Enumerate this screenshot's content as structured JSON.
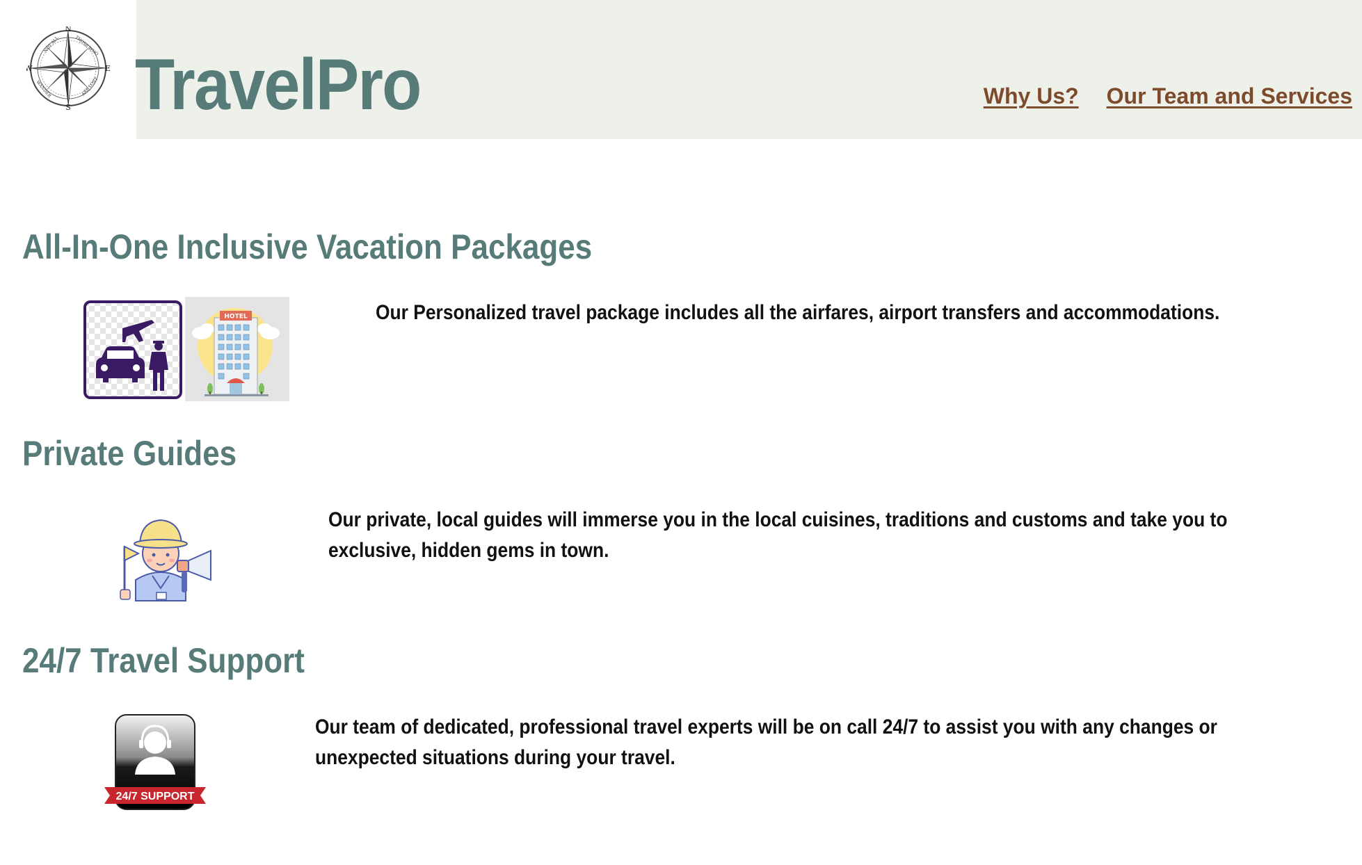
{
  "header": {
    "logo_icon": "compass-rose-icon",
    "logo_text": {
      "north": "N",
      "south": "S",
      "east": "E",
      "west": "W",
      "ring_top_left": "NOT ALL",
      "ring_top_right": "THOSE WHO",
      "ring_bottom_left": "WANDER",
      "ring_bottom_right": "ARE LOST"
    },
    "brand": "TravelPro",
    "nav": [
      {
        "label": "Why Us?"
      },
      {
        "label": "Our Team and Services"
      }
    ]
  },
  "sections": [
    {
      "title": "All-In-One Inclusive Vacation Packages",
      "icons": [
        "airport-transfer-icon",
        "hotel-icon"
      ],
      "hotel_sign": "HOTEL",
      "text": "Our Personalized travel package includes all the airfares, airport transfers and accommodations."
    },
    {
      "title": "Private Guides",
      "icons": [
        "tour-guide-icon"
      ],
      "text": "Our private, local guides will immerse you in the local cuisines, traditions and customs and take you to exclusive, hidden gems in town."
    },
    {
      "title": "24/7 Travel Support",
      "icons": [
        "support-agent-icon"
      ],
      "badge_text": "24/7 SUPPORT",
      "text": "Our team of dedicated, professional travel experts will be on call 24/7 to assist you with any changes or unexpected situations during your travel."
    }
  ],
  "colors": {
    "brand": "#577b78",
    "header_band": "#edf1ea",
    "nav_link": "#7d4b2c",
    "body_text": "#111111"
  }
}
